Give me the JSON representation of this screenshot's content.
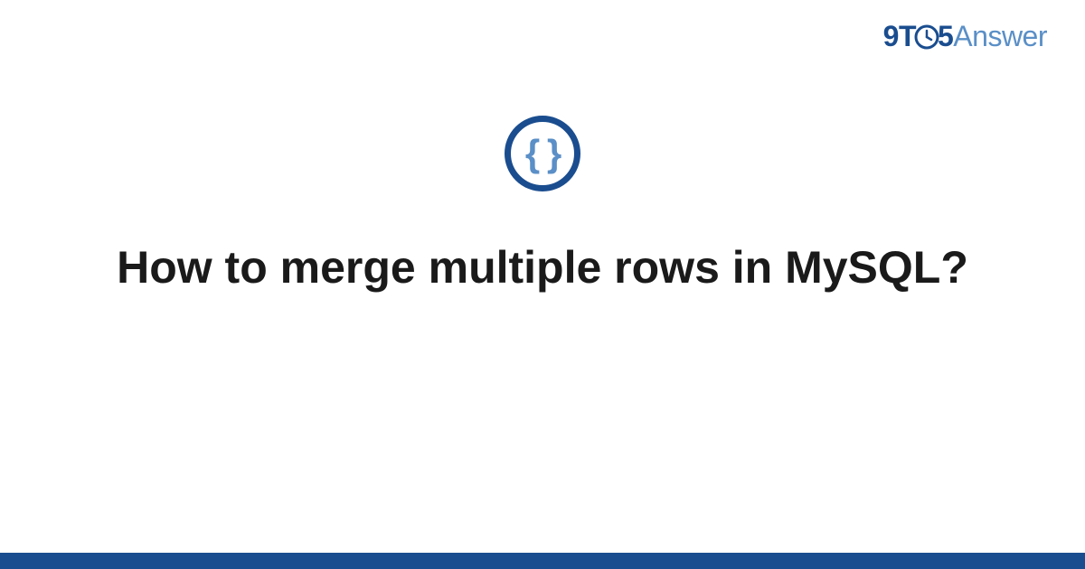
{
  "header": {
    "logo": {
      "part1": "9T",
      "part2": "5",
      "part3": "Answer"
    }
  },
  "main": {
    "icon_name": "code-braces-icon",
    "icon_glyph": "{ }",
    "title": "How to merge multiple rows in MySQL?"
  },
  "colors": {
    "brand_dark": "#1a4d8f",
    "brand_light": "#5a8fc7",
    "text": "#1a1a1a"
  }
}
